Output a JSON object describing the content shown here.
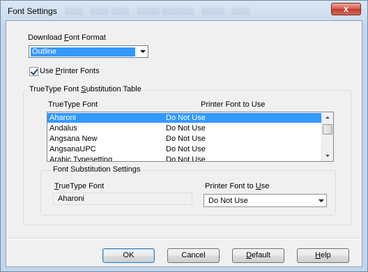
{
  "window": {
    "title": "Font Settings",
    "close_glyph": "x"
  },
  "download_font_format": {
    "label_pre": "Download ",
    "label_key": "F",
    "label_post": "ont Format",
    "selected": "Outline"
  },
  "use_printer_fonts": {
    "checked": true,
    "label_pre": "Use ",
    "label_key": "P",
    "label_post": "rinter Fonts"
  },
  "substitution_table": {
    "group_title_pre": "TrueType Font ",
    "group_title_key": "S",
    "group_title_post": "ubstitution Table",
    "col_truetype": "TrueType Font",
    "col_printer": "Printer Font to Use",
    "rows": [
      {
        "font": "Aharoni",
        "printer": "Do Not Use",
        "selected": true
      },
      {
        "font": "Andalus",
        "printer": "Do Not Use"
      },
      {
        "font": "Angsana New",
        "printer": "Do Not Use"
      },
      {
        "font": "AngsanaUPC",
        "printer": "Do Not Use"
      },
      {
        "font": "Arabic Typesetting",
        "printer": "Do Not Use"
      }
    ]
  },
  "substitution_settings": {
    "group_title": "Font Substitution Settings",
    "truetype_label_key": "T",
    "truetype_label_post": "rueType Font",
    "truetype_value": "Aharoni",
    "printer_label_pre": "Printer Font to ",
    "printer_label_key": "U",
    "printer_label_post": "se",
    "printer_value": "Do Not Use"
  },
  "buttons": {
    "ok": "OK",
    "cancel": "Cancel",
    "default_key": "D",
    "default_post": "efault",
    "help_key": "H",
    "help_post": "elp"
  }
}
